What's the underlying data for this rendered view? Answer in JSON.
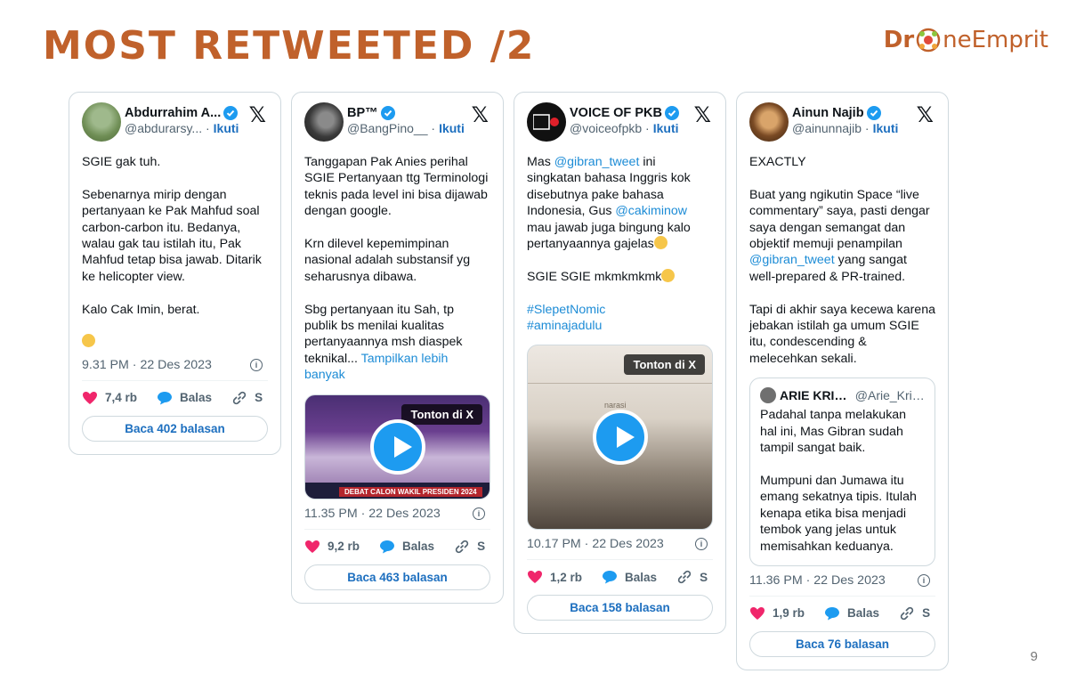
{
  "slide": {
    "title": "MOST RETWEETED /2",
    "brand_left": "Dr",
    "brand_right": "neEmprit",
    "page_number": "9",
    "brand_color": "#c0612b"
  },
  "ui": {
    "follow": "Ikuti",
    "reply": "Balas",
    "share": "S",
    "watch": "Tonton di X",
    "x_logo": "𝕏",
    "info": "i"
  },
  "cards": [
    {
      "name": "Abdurrahim A...",
      "handle": "@abdurarsy...",
      "text_1": "SGIE gak tuh.\n\nSebenarnya mirip dengan pertanyaan ke Pak Mahfud soal carbon-carbon itu. Bedanya, walau gak tau istilah itu, Pak Mahfud tetap bisa jawab. Ditarik ke helicopter view.\n\nKalo Cak Imin, berat.\n\n",
      "time": "9.31 PM · 22 Des 2023",
      "likes": "7,4 rb",
      "read": "Baca 402 balasan"
    },
    {
      "name": "BP™",
      "handle": "@BangPino__",
      "text_1": "Tanggapan Pak Anies perihal SGIE Pertanyaan ttg Terminologi teknis pada level ini bisa dijawab dengan google.\n\nKrn dilevel kepemimpinan nasional adalah substansif yg seharusnya dibawa.\n\nSbg pertanyaan itu Sah, tp publik bs menilai kualitas pertanyaannya msh diaspek teknikal... ",
      "show_more": "Tampilkan lebih banyak",
      "video_banner": "DEBAT CALON WAKIL PRESIDEN 2024",
      "time": "11.35 PM · 22 Des 2023",
      "likes": "9,2 rb",
      "read": "Baca 463 balasan"
    },
    {
      "name": "VOICE OF PKB",
      "handle": "@voiceofpkb",
      "text_1": "Mas ",
      "mention_1": "@gibran_tweet",
      "text_2": " ini singkatan bahasa Inggris kok disebutnya pake bahasa Indonesia, Gus ",
      "mention_2": "@cakiminow",
      "text_3": " mau jawab juga bingung kalo pertanyaannya gajelas",
      "text_4": "\n\nSGIE SGIE mkmkmkmk",
      "hashtag_1": "#SlepetNomic",
      "hashtag_2": "#aminajadulu",
      "video_label": "narasi",
      "time": "10.17 PM · 22 Des 2023",
      "likes": "1,2 rb",
      "read": "Baca 158 balasan"
    },
    {
      "name": "Ainun Najib",
      "handle": "@ainunnajib",
      "text_1": "EXACTLY\n\nBuat yang ngikutin Space “live commentary” saya, pasti dengar saya dengan semangat dan objektif memuji penampilan ",
      "mention_1": "@gibran_tweet",
      "text_2": " yang sangat well-prepared & PR-trained.\n\nTapi di akhir saya kecewa karena jebakan istilah ga umum SGIE itu, condescending & melecehkan sekali.",
      "quote_name": "ARIE KRIT...",
      "quote_handle": "@Arie_Krit...",
      "quote_text": "Padahal tanpa melakukan hal ini, Mas Gibran sudah tampil sangat baik.\n\nMumpuni dan Jumawa itu emang sekatnya tipis. Itulah kenapa etika bisa menjadi tembok yang jelas untuk memisahkan keduanya.",
      "time": "11.36 PM · 22 Des 2023",
      "likes": "1,9 rb",
      "read": "Baca 76 balasan"
    }
  ]
}
